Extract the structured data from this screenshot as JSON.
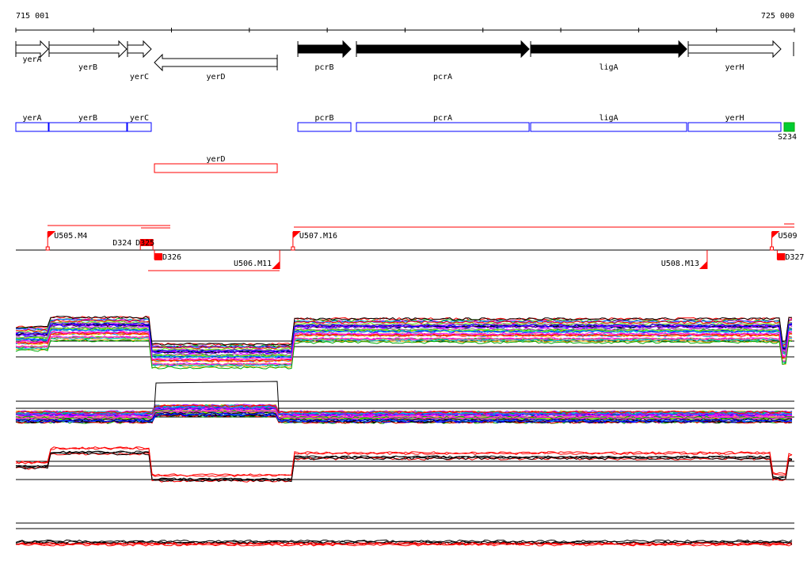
{
  "ruler": {
    "start_label": "715 001",
    "end_label": "725 000",
    "start": 715001,
    "end": 725000,
    "tick_step": 1000
  },
  "genes": [
    {
      "name": "yerA",
      "start": 715001,
      "end": 715418,
      "strand": "+",
      "fill": "#ffffff"
    },
    {
      "name": "yerB",
      "start": 715428,
      "end": 716425,
      "strand": "+",
      "fill": "#ffffff"
    },
    {
      "name": "yerC",
      "start": 716435,
      "end": 716740,
      "strand": "+",
      "fill": "#ffffff"
    },
    {
      "name": "yerD",
      "start": 716781,
      "end": 718358,
      "strand": "-",
      "fill": "#ffffff"
    },
    {
      "name": "pcrB",
      "start": 718623,
      "end": 719304,
      "strand": "+",
      "fill": "#000000"
    },
    {
      "name": "pcrA",
      "start": 719375,
      "end": 721593,
      "strand": "+",
      "fill": "#000000"
    },
    {
      "name": "ligA",
      "start": 721613,
      "end": 723617,
      "strand": "+",
      "fill": "#000000"
    },
    {
      "name": "yerH",
      "start": 723637,
      "end": 724827,
      "strand": "+",
      "fill": "#ffffff"
    }
  ],
  "annotation_boxes": [
    {
      "name": "yerA",
      "start": 715001,
      "end": 715418,
      "row": 0,
      "color": "#0000ff"
    },
    {
      "name": "yerB",
      "start": 715428,
      "end": 716425,
      "row": 0,
      "color": "#0000ff"
    },
    {
      "name": "yerC",
      "start": 716435,
      "end": 716740,
      "row": 0,
      "color": "#0000ff"
    },
    {
      "name": "pcrB",
      "start": 718623,
      "end": 719304,
      "row": 0,
      "color": "#0000ff"
    },
    {
      "name": "pcrA",
      "start": 719375,
      "end": 721593,
      "row": 0,
      "color": "#0000ff"
    },
    {
      "name": "ligA",
      "start": 721613,
      "end": 723617,
      "row": 0,
      "color": "#0000ff"
    },
    {
      "name": "yerH",
      "start": 723637,
      "end": 724827,
      "row": 0,
      "color": "#0000ff"
    },
    {
      "name": "yerD",
      "start": 716781,
      "end": 718358,
      "row": 1,
      "color": "#ff0000"
    }
  ],
  "feature_s234": {
    "label": "S234",
    "color": "#00cc33"
  },
  "transcription_units": [
    {
      "label": "U505.M4",
      "pos": 715410,
      "strand": "+"
    },
    {
      "label": "U507.M16",
      "pos": 718560,
      "strand": "+"
    },
    {
      "label": "U509",
      "pos": 724710,
      "strand": "+"
    },
    {
      "label": "U506.M11",
      "pos": 718390,
      "strand": "-"
    },
    {
      "label": "U508.M13",
      "pos": 723880,
      "strand": "-"
    }
  ],
  "downregulated_sites": [
    {
      "label": "D324",
      "pos": 716600,
      "strand": "+"
    },
    {
      "label": "D325",
      "pos": 716660,
      "strand": "+"
    },
    {
      "label": "D326",
      "pos": 716781,
      "strand": "-"
    },
    {
      "label": "D327",
      "pos": 724780,
      "strand": "-"
    }
  ],
  "colors": {
    "accent": "#ff0000",
    "gene_box": "#0000ff",
    "axis": "#000000"
  }
}
